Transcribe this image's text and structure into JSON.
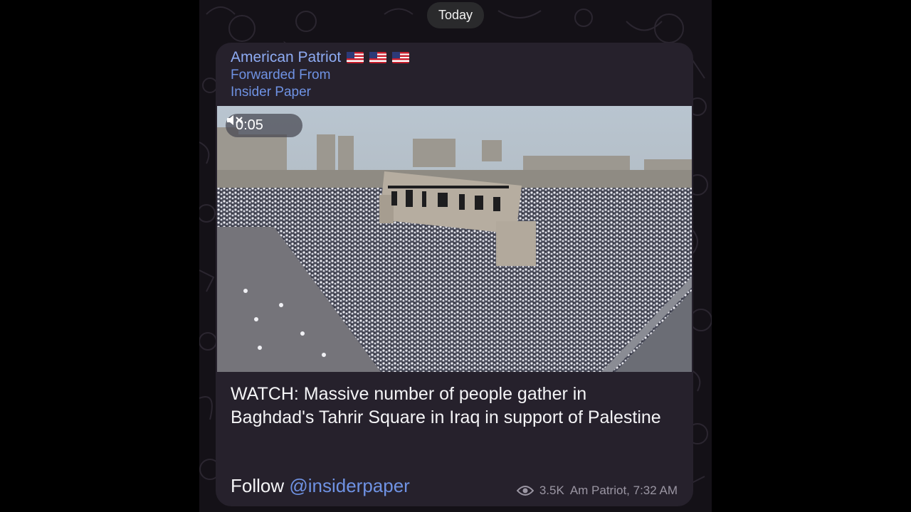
{
  "date_separator": "Today",
  "message": {
    "sender": "American Patriot",
    "sender_flags": [
      "us-flag-icon",
      "us-flag-icon",
      "us-flag-icon"
    ],
    "forwarded_label": "Forwarded From",
    "forwarded_source": "Insider Paper",
    "video": {
      "timer": "0:05",
      "mute_icon": "muted-speaker-icon"
    },
    "caption": "WATCH: Massive number of people gather in Baghdad's Tahrir Square in Iraq in support of Palestine",
    "follow_prefix": "Follow ",
    "follow_handle": "@insiderpaper",
    "views": "3.5K",
    "signature_time": "Am Patriot, 7:32 AM",
    "views_icon": "eye-icon"
  },
  "colors": {
    "bubble": "#26212c",
    "link": "#6f92e3",
    "sender": "#8eabf3",
    "meta": "#9b96a3"
  }
}
